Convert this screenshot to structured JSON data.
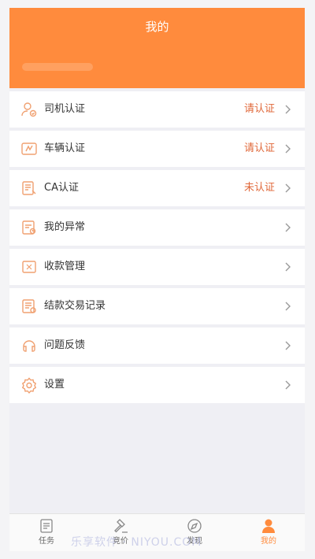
{
  "header": {
    "title": "我的"
  },
  "menu": {
    "items": [
      {
        "label": "司机认证",
        "status": "请认证",
        "icon": "driver-id-icon"
      },
      {
        "label": "车辆认证",
        "status": "请认证",
        "icon": "vehicle-card-icon"
      },
      {
        "label": "CA认证",
        "status": "未认证",
        "icon": "certificate-icon"
      },
      {
        "label": "我的异常",
        "status": "",
        "icon": "exception-doc-icon"
      },
      {
        "label": "收款管理",
        "status": "",
        "icon": "payment-icon"
      },
      {
        "label": "结款交易记录",
        "status": "",
        "icon": "transaction-record-icon"
      },
      {
        "label": "问题反馈",
        "status": "",
        "icon": "feedback-icon"
      },
      {
        "label": "设置",
        "status": "",
        "icon": "settings-gear-icon"
      }
    ]
  },
  "tabbar": {
    "tabs": [
      {
        "label": "任务",
        "icon": "task-icon",
        "active": false
      },
      {
        "label": "竞价",
        "icon": "gavel-icon",
        "active": false
      },
      {
        "label": "发现",
        "icon": "compass-icon",
        "active": false
      },
      {
        "label": "我的",
        "icon": "profile-icon",
        "active": true
      }
    ]
  },
  "watermark": {
    "text": "乐享软件 · NIYOU.COM"
  },
  "colors": {
    "accent": "#ff8b3d",
    "status": "#e0683a",
    "background": "#efeff4"
  }
}
